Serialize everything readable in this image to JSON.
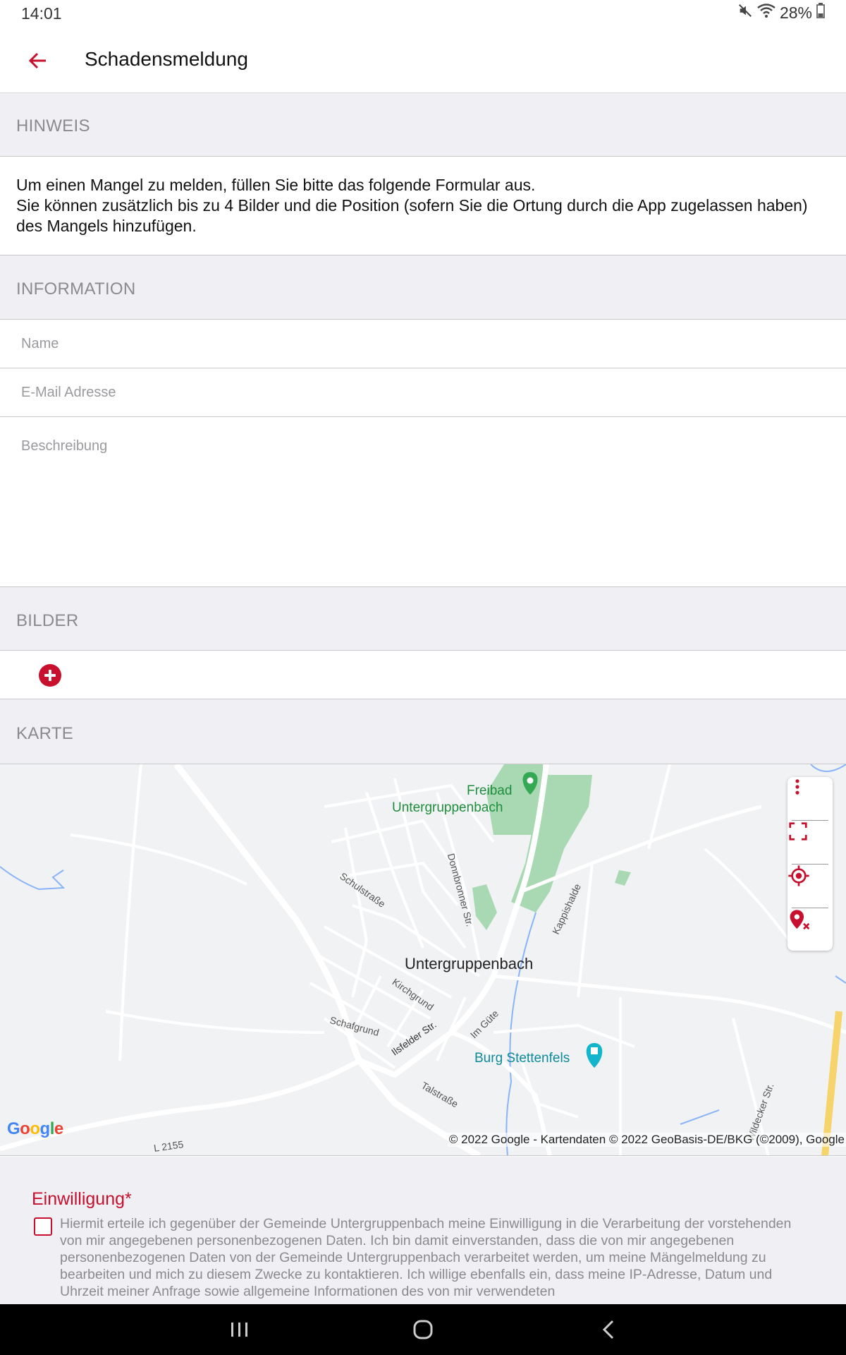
{
  "status_bar": {
    "time": "14:01",
    "battery": "28%",
    "icons": [
      "mute-icon",
      "wifi-icon",
      "battery-icon"
    ]
  },
  "app_bar": {
    "title": "Schadensmeldung",
    "back_icon": "arrow-left-icon"
  },
  "colors": {
    "accent": "#c8102e",
    "section_bg": "#efeff4",
    "section_label": "#8a8a8f"
  },
  "sections": {
    "hinweis": "HINWEIS",
    "information": "INFORMATION",
    "bilder": "BILDER",
    "karte": "KARTE"
  },
  "hint": {
    "line1": "Um einen Mangel zu melden, füllen Sie bitte das folgende Formular aus.",
    "line2": "Sie können zusätzlich bis zu 4 Bilder und die Position (sofern Sie die Ortung durch die App zugelassen haben) des Mangels hinzufügen."
  },
  "form": {
    "name_placeholder": "Name",
    "email_placeholder": "E-Mail Adresse",
    "description_placeholder": "Beschreibung",
    "name_value": "",
    "email_value": "",
    "description_value": ""
  },
  "images": {
    "add_icon": "plus-circle-icon"
  },
  "map": {
    "labels": {
      "freibad_1": "Freibad",
      "freibad_2": "Untergruppenbach",
      "town": "Untergruppenbach",
      "burg": "Burg Stettenfels",
      "schulstrasse": "Schulstraße",
      "donnbronner": "Donnbronner Str.",
      "kappishalde": "Kappishalde",
      "kirchgrund": "Kirchgrund",
      "schafgrund": "Schafgrund",
      "ilsfelder": "Ilsfelder Str.",
      "im_guete": "Im Güte",
      "talstrasse": "Talstraße",
      "l2155": "L 2155",
      "wildecker": "Wildecker Str."
    },
    "controls": [
      "more-vert-icon",
      "fullscreen-icon",
      "my-location-icon",
      "clear-location-icon"
    ],
    "google": "Google",
    "copyright": "© 2022 Google - Kartendaten © 2022 GeoBasis-DE/BKG (©2009), Google"
  },
  "consent": {
    "title": "Einwilligung*",
    "text": "Hiermit erteile ich gegenüber der Gemeinde Untergruppenbach meine Einwilligung in die Verarbeitung der vorstehenden von mir angegebenen personenbezogenen Daten. Ich bin damit einverstanden, dass die von mir angegebenen personenbezogenen Daten von der Gemeinde Untergruppenbach verarbeitet werden, um meine Mängelmeldung zu bearbeiten und mich zu diesem Zwecke zu kontaktieren. Ich willige ebenfalls ein, dass meine IP-Adresse, Datum und Uhrzeit meiner Anfrage sowie allgemeine Informationen des von mir verwendeten",
    "checked": false
  },
  "nav_bar": {
    "icons": [
      "recent-apps-icon",
      "home-icon",
      "back-icon"
    ]
  }
}
